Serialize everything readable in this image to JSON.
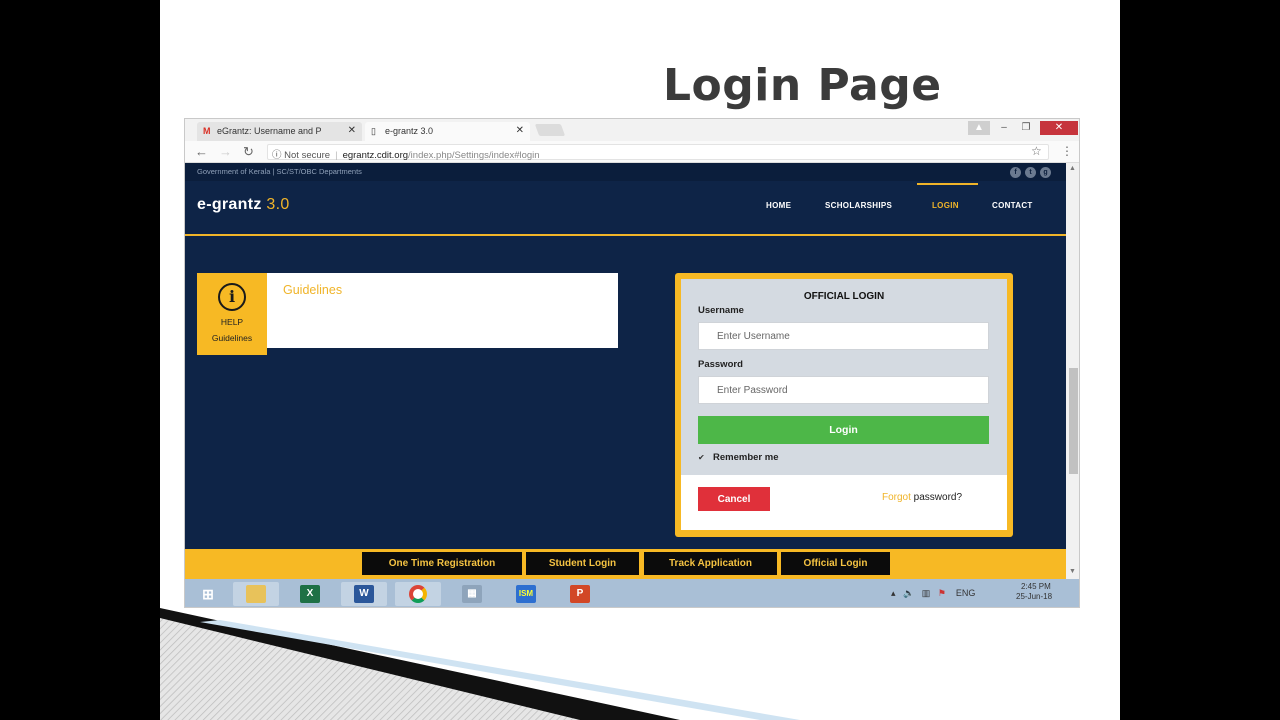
{
  "slide": {
    "title": "Login Page"
  },
  "browser": {
    "tabs": [
      {
        "title": "eGrantz: Username and P",
        "icon": "gmail-icon"
      },
      {
        "title": "e-grantz 3.0",
        "icon": "page-icon"
      }
    ],
    "address": {
      "security": "Not secure",
      "host": "egrantz.cdit.org",
      "path": "/index.php/Settings/index#login"
    }
  },
  "site": {
    "gov_text": "Government of Kerala | SC/ST/OBC Departments",
    "brand_name": "e-grantz",
    "brand_version": "3.0",
    "nav": [
      "HOME",
      "SCHOLARSHIPS",
      "LOGIN",
      "CONTACT"
    ],
    "active_nav": "LOGIN",
    "help": {
      "label": "HELP",
      "sub": "Guidelines"
    },
    "guidelines_title": "Guidelines",
    "login": {
      "heading": "OFFICIAL LOGIN",
      "username_label": "Username",
      "username_placeholder": "Enter Username",
      "password_label": "Password",
      "password_placeholder": "Enter Password",
      "login_button": "Login",
      "remember_label": "Remember me",
      "remember_checked": true,
      "cancel_button": "Cancel",
      "forgot_link": "Forgot",
      "forgot_rest": " password?"
    },
    "footer_buttons": [
      "One Time Registration",
      "Student Login",
      "Track Application",
      "Official Login"
    ]
  },
  "taskbar": {
    "apps": [
      "start-icon",
      "file-explorer-icon",
      "excel-icon",
      "word-icon",
      "chrome-icon",
      "calculator-icon",
      "gism-icon",
      "powerpoint-icon"
    ],
    "language": "ENG",
    "time": "2:45 PM",
    "date": "25-Jun-18"
  },
  "colors": {
    "page_bg": "#0e2447",
    "accent": "#f0b429",
    "login_green": "#4db748",
    "cancel_red": "#e0303a"
  }
}
